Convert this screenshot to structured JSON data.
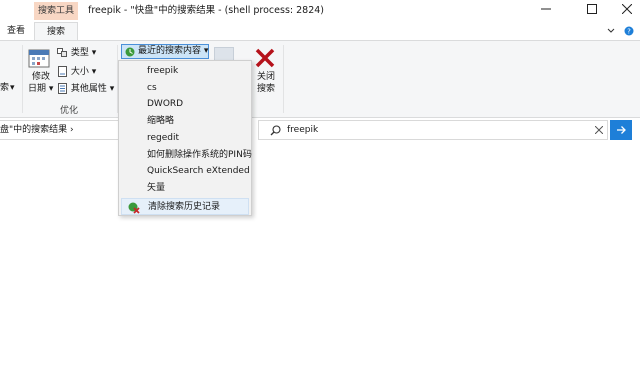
{
  "titlebar": {
    "context_tab": "搜索工具",
    "title": "freepik - \"快盘\"中的搜索结果 - (shell process: 2824)"
  },
  "tabs": {
    "view": "查看",
    "search": "搜索"
  },
  "ribbon": {
    "modified_line1": "修改",
    "modified_line2": "日期",
    "type_label": "类型",
    "size_label": "大小",
    "other_props_label": "其他属性",
    "group_optimize": "优化",
    "recent_searches": "最近的搜索内容",
    "close_line1": "关闭",
    "close_line2": "搜索",
    "left_partial": "索"
  },
  "address": {
    "path": "盘\"中的搜索结果"
  },
  "search": {
    "value": "freepik"
  },
  "dropdown": {
    "items": [
      "freepik",
      "cs",
      "DWORD",
      "缩略略",
      "regedit",
      "如何删除操作系统的PIN码",
      "QuickSearch eXtended",
      "矢量"
    ],
    "clear_history": "清除搜索历史记录"
  },
  "colors": {
    "accent": "#1e7fd8",
    "context_tab_bg": "#f8d7c4",
    "close_x": "#b5121b",
    "selected_bg": "#cce4f7"
  }
}
